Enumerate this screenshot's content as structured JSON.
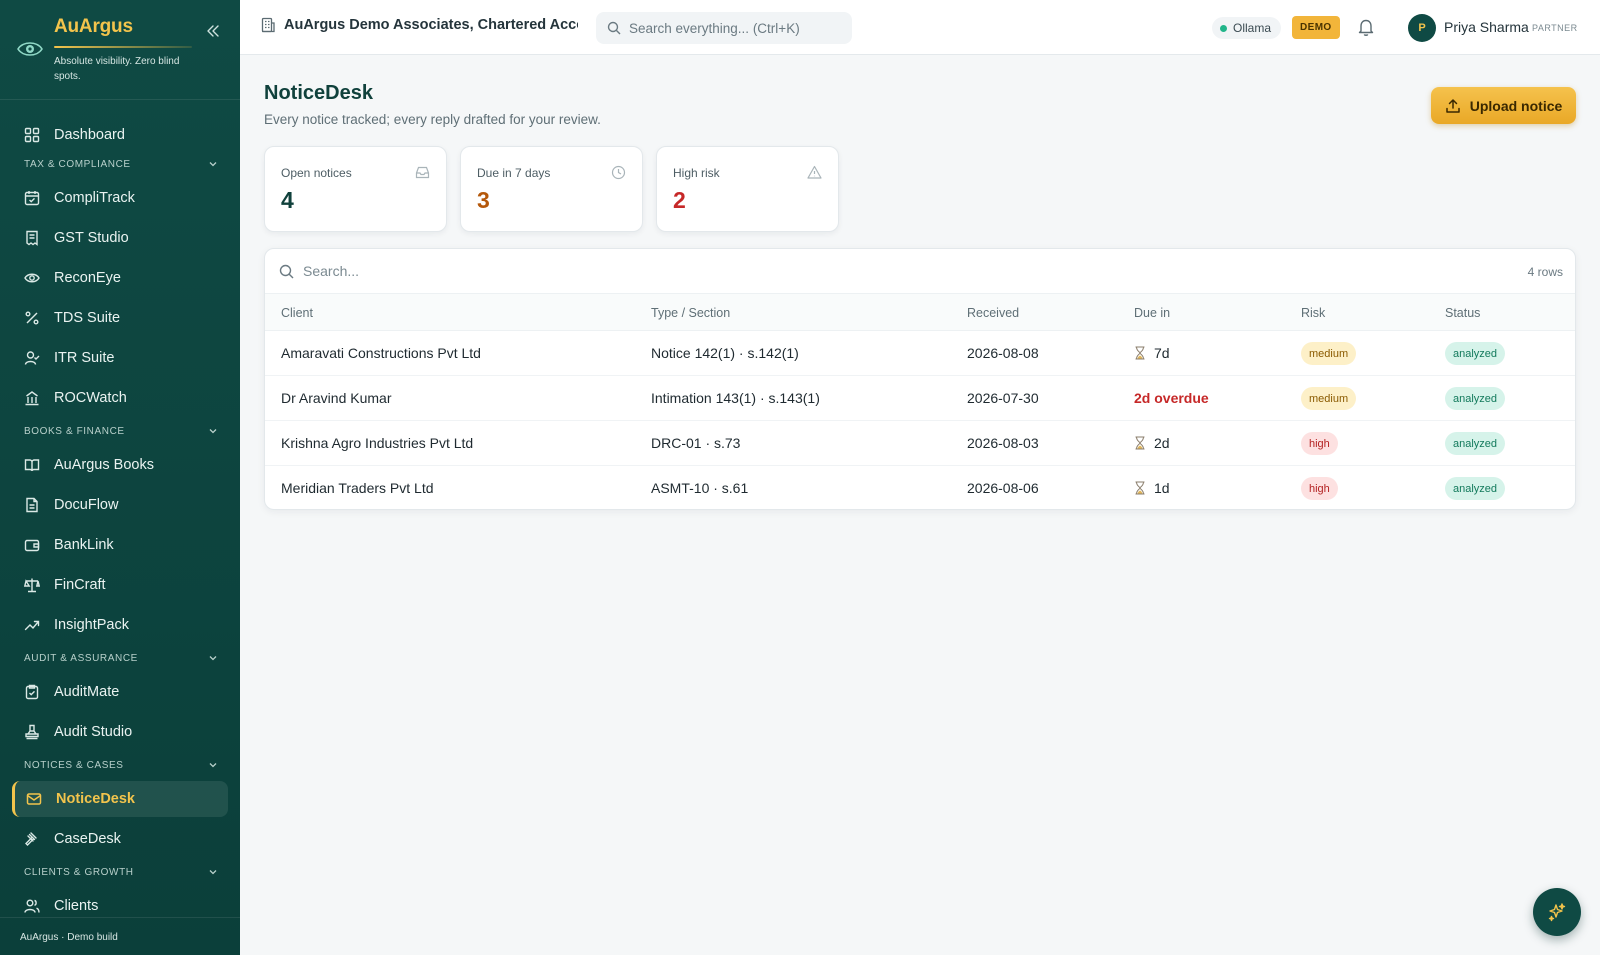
{
  "brand": {
    "name": "AuArgus",
    "tagline": "Absolute visibility. Zero blind spots."
  },
  "sidebar": {
    "items": [
      {
        "label": "Dashboard",
        "icon": "dashboard-icon"
      },
      {
        "section": "TAX & COMPLIANCE"
      },
      {
        "label": "CompliTrack",
        "icon": "calendar-check-icon"
      },
      {
        "label": "GST Studio",
        "icon": "receipt-icon"
      },
      {
        "label": "ReconEye",
        "icon": "eye-icon"
      },
      {
        "label": "TDS Suite",
        "icon": "percent-icon"
      },
      {
        "label": "ITR Suite",
        "icon": "user-check-icon"
      },
      {
        "label": "ROCWatch",
        "icon": "building-icon"
      },
      {
        "section": "BOOKS & FINANCE"
      },
      {
        "label": "AuArgus Books",
        "icon": "book-open-icon"
      },
      {
        "label": "DocuFlow",
        "icon": "document-icon"
      },
      {
        "label": "BankLink",
        "icon": "wallet-icon"
      },
      {
        "label": "FinCraft",
        "icon": "scale-icon"
      },
      {
        "label": "InsightPack",
        "icon": "trending-up-icon"
      },
      {
        "section": "AUDIT & ASSURANCE"
      },
      {
        "label": "AuditMate",
        "icon": "clipboard-check-icon"
      },
      {
        "label": "Audit Studio",
        "icon": "stamp-icon"
      },
      {
        "section": "NOTICES & CASES"
      },
      {
        "label": "NoticeDesk",
        "icon": "mail-icon",
        "active": true
      },
      {
        "label": "CaseDesk",
        "icon": "gavel-icon"
      },
      {
        "section": "CLIENTS & GROWTH"
      },
      {
        "label": "Clients",
        "icon": "users-icon"
      }
    ],
    "footer": "AuArgus · Demo build"
  },
  "topbar": {
    "org": "AuArgus Demo Associates, Chartered Accou...",
    "search_placeholder": "Search everything...  (Ctrl+K)",
    "ollama": "Ollama",
    "demo_badge": "DEMO",
    "user": {
      "initial": "P",
      "name": "Priya Sharma",
      "role": "PARTNER"
    }
  },
  "page": {
    "title": "NoticeDesk",
    "subtitle": "Every notice tracked; every reply drafted for your review.",
    "upload_label": "Upload notice"
  },
  "stats": [
    {
      "label": "Open notices",
      "value": "4",
      "color": "#10413c",
      "icon": "inbox-icon"
    },
    {
      "label": "Due in 7 days",
      "value": "3",
      "color": "#b5580b",
      "icon": "clock-icon"
    },
    {
      "label": "High risk",
      "value": "2",
      "color": "#c62828",
      "icon": "alert-triangle-icon"
    }
  ],
  "table": {
    "search_placeholder": "Search...",
    "row_count": "4 rows",
    "columns": [
      "Client",
      "Type / Section",
      "Received",
      "Due in",
      "Risk",
      "Status"
    ],
    "rows": [
      {
        "client": "Amaravati Constructions Pvt Ltd",
        "type": "Notice 142(1) · s.142(1)",
        "received": "2026-08-08",
        "due": "7d",
        "overdue": false,
        "risk": "medium",
        "status": "analyzed"
      },
      {
        "client": "Dr Aravind Kumar",
        "type": "Intimation 143(1) · s.143(1)",
        "received": "2026-07-30",
        "due": "2d overdue",
        "overdue": true,
        "risk": "medium",
        "status": "analyzed"
      },
      {
        "client": "Krishna Agro Industries Pvt Ltd",
        "type": "DRC-01 · s.73",
        "received": "2026-08-03",
        "due": "2d",
        "overdue": false,
        "risk": "high",
        "status": "analyzed"
      },
      {
        "client": "Meridian Traders Pvt Ltd",
        "type": "ASMT-10 · s.61",
        "received": "2026-08-06",
        "due": "1d",
        "overdue": false,
        "risk": "high",
        "status": "analyzed"
      }
    ]
  },
  "colors": {
    "sidebar": "#0f4a44",
    "accent": "#f3c44c",
    "danger": "#c62828"
  }
}
